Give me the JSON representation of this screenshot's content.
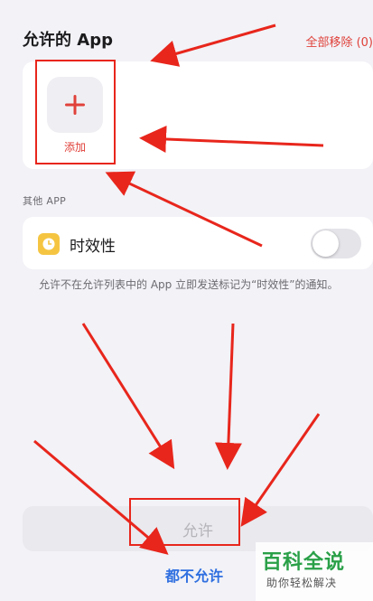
{
  "allowed": {
    "title": "允许的 App",
    "remove_all": "全部移除 (0)",
    "add_label": "添加"
  },
  "other": {
    "section_label": "其他 APP",
    "apps": [
      {
        "name": "时效性",
        "icon": "clock-icon",
        "enabled": false
      }
    ],
    "description": "允许不在允许列表中的 App 立即发送标记为“时效性”的通知。"
  },
  "actions": {
    "allow_label": "允许",
    "deny_label": "都不允许"
  },
  "watermark": {
    "title": "百科全说",
    "subtitle": "助你轻松解决"
  },
  "colors": {
    "accent_red": "#e0413a",
    "link_blue": "#2f6fe0",
    "annotation_red": "#e8261c"
  }
}
